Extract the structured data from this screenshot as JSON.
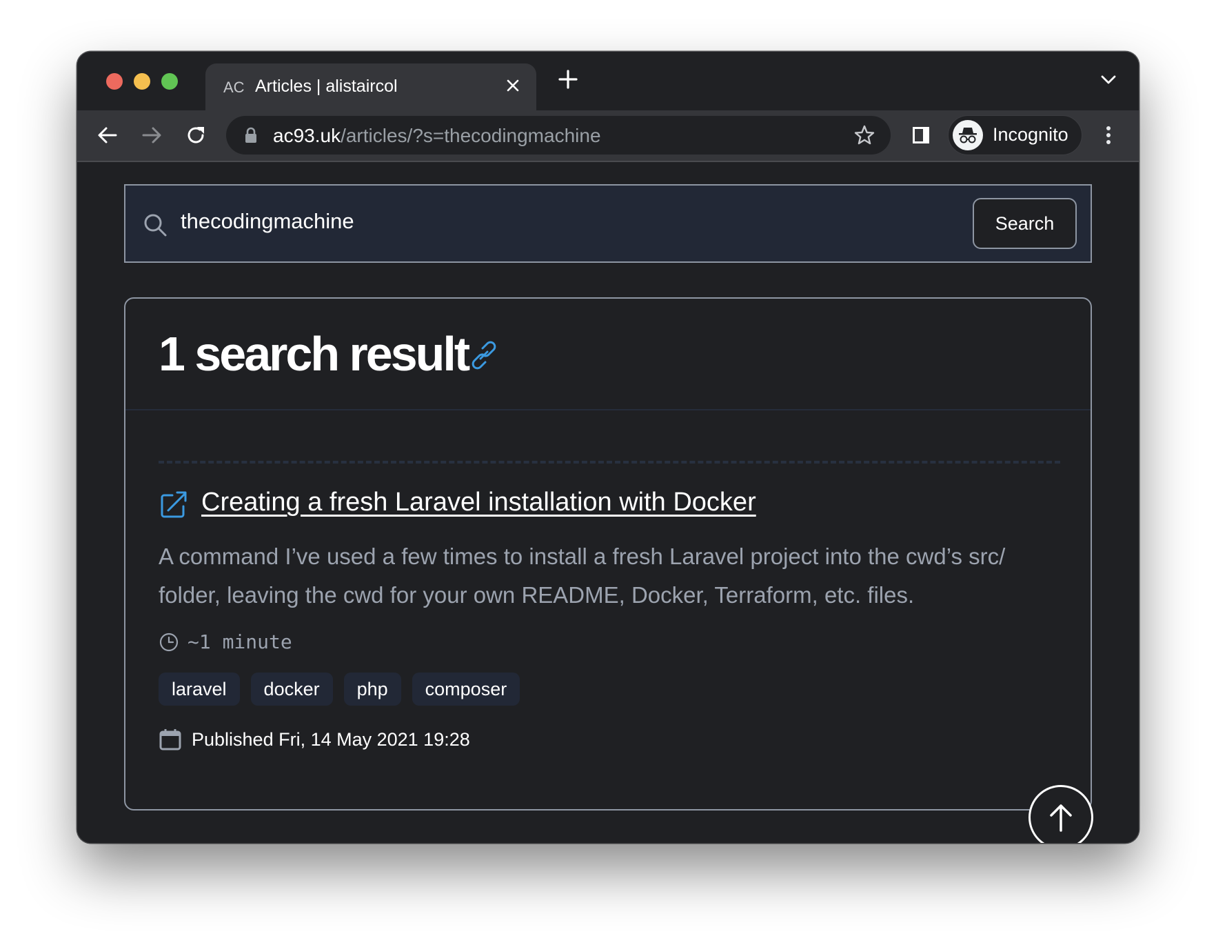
{
  "browser": {
    "tab": {
      "favicon_text": "AC",
      "title": "Articles | alistaircol",
      "close_icon": "close-icon"
    },
    "new_tab_icon": "plus-icon",
    "tab_list_icon": "chevron-down-icon",
    "nav": {
      "back_icon": "arrow-left-icon",
      "forward_icon": "arrow-right-icon",
      "reload_icon": "reload-icon"
    },
    "address_bar": {
      "lock_icon": "lock-icon",
      "domain": "ac93.uk",
      "path": "/articles/?s=thecodingmachine",
      "bookmark_icon": "star-icon"
    },
    "side_panel_icon": "side-panel-icon",
    "profile": {
      "label": "Incognito",
      "icon": "incognito-icon"
    },
    "menu_icon": "more-vertical-icon",
    "traffic_lights": {
      "close": "#ed6a5e",
      "minimize": "#f5bf4f",
      "maximize": "#61c554"
    }
  },
  "search": {
    "icon": "search-icon",
    "value": "thecodingmachine",
    "button_label": "Search"
  },
  "results": {
    "heading": "1 search result",
    "heading_link_icon": "link-icon",
    "items": [
      {
        "title": "Creating a fresh Laravel installation with Docker",
        "external_icon": "external-link-icon",
        "description": "A command I’ve used a few times to install a fresh Laravel project into the cwd’s src/ folder, leaving the cwd for your own README, Docker, Terraform, etc. files.",
        "read_time": "~1 minute",
        "tags": [
          "laravel",
          "docker",
          "php",
          "composer"
        ],
        "published": "Published Fri, 14 May 2021 19:28"
      }
    ]
  },
  "scroll_top_icon": "arrow-up-icon",
  "colors": {
    "accent": "#3b9ae1",
    "page_bg": "#1f2023",
    "search_bg": "#222836",
    "tag_bg": "#222836",
    "muted_text": "#9ca3af",
    "border": "#8e96a3"
  }
}
